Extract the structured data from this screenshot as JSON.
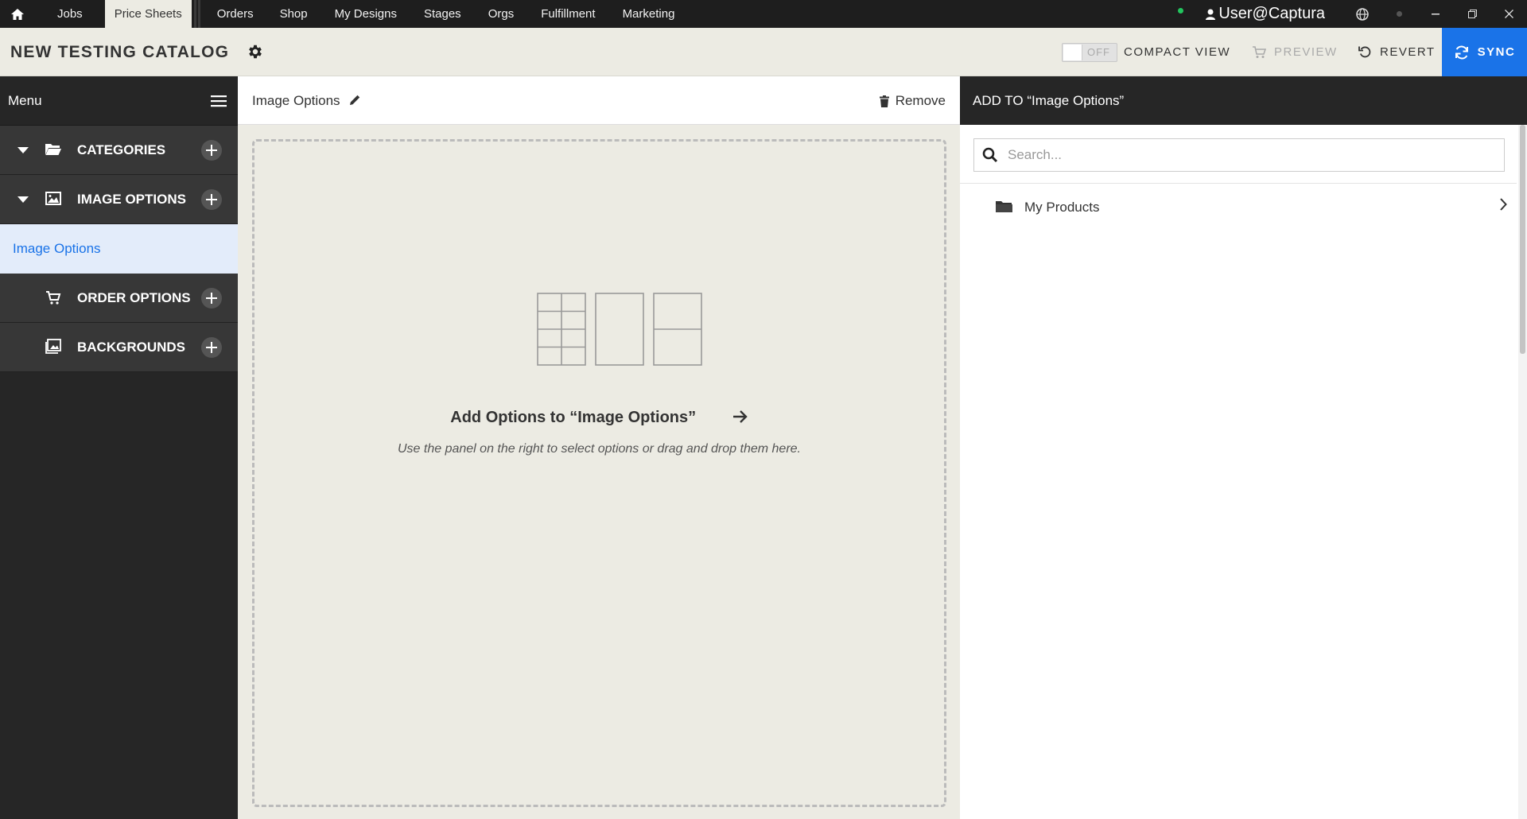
{
  "topnav": {
    "tabs": [
      {
        "label": "Jobs"
      },
      {
        "label": "Price Sheets",
        "active": true
      },
      {
        "label": "Orders"
      },
      {
        "label": "Shop"
      },
      {
        "label": "My Designs"
      },
      {
        "label": "Stages"
      },
      {
        "label": "Orgs"
      },
      {
        "label": "Fulfillment"
      },
      {
        "label": "Marketing"
      }
    ],
    "user": "User@Captura",
    "status_color": "#22c55e"
  },
  "header": {
    "catalog_title": "NEW TESTING CATALOG",
    "toggle_state": "OFF",
    "compact_view": "COMPACT VIEW",
    "preview": "PREVIEW",
    "revert": "REVERT",
    "sync": "SYNC",
    "accent": "#1a73e8"
  },
  "sidebar": {
    "menu_label": "Menu",
    "items": [
      {
        "label": "CATEGORIES",
        "icon": "folder-open-icon"
      },
      {
        "label": "IMAGE OPTIONS",
        "icon": "image-icon"
      },
      {
        "label": "Image Options",
        "selected": true
      },
      {
        "label": "ORDER OPTIONS",
        "icon": "cart-icon"
      },
      {
        "label": "BACKGROUNDS",
        "icon": "backgrounds-icon"
      }
    ]
  },
  "center": {
    "title": "Image Options",
    "remove": "Remove",
    "empty_title": "Add Options to “Image Options”",
    "empty_subtitle": "Use the panel on the right to select options or drag and drop them here."
  },
  "right_panel": {
    "title": "ADD TO “Image Options”",
    "search_placeholder": "Search...",
    "rows": [
      {
        "label": "My Products",
        "icon": "folder-icon"
      }
    ]
  }
}
